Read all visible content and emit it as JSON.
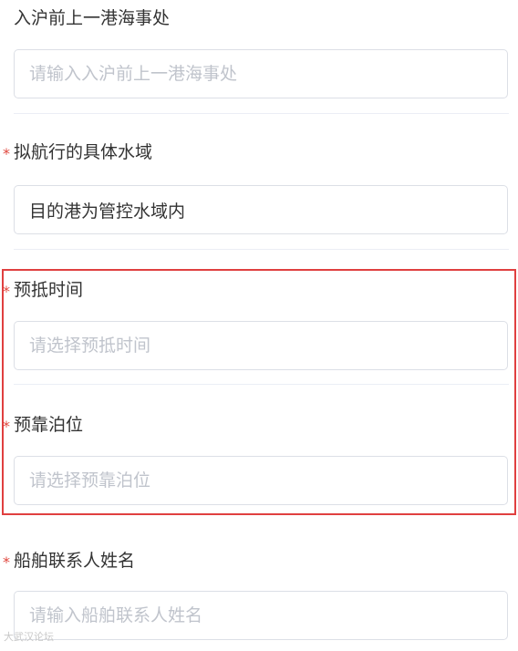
{
  "form": {
    "fields": [
      {
        "label": "入沪前上一港海事处",
        "required": false,
        "value": "",
        "placeholder": "请输入入沪前上一港海事处"
      },
      {
        "label": "拟航行的具体水域",
        "required": true,
        "value": "目的港为管控水域内",
        "placeholder": ""
      },
      {
        "label": "预抵时间",
        "required": true,
        "value": "",
        "placeholder": "请选择预抵时间"
      },
      {
        "label": "预靠泊位",
        "required": true,
        "value": "",
        "placeholder": "请选择预靠泊位"
      },
      {
        "label": "船舶联系人姓名",
        "required": true,
        "value": "",
        "placeholder": "请输入船舶联系人姓名"
      }
    ],
    "required_mark": "*"
  },
  "colors": {
    "required": "#e0483f",
    "highlight_border": "#e04040",
    "placeholder": "#c0c4cc",
    "input_border": "#dcdfe6",
    "text": "#333333"
  },
  "watermark": {
    "text": "大武汉论坛"
  }
}
